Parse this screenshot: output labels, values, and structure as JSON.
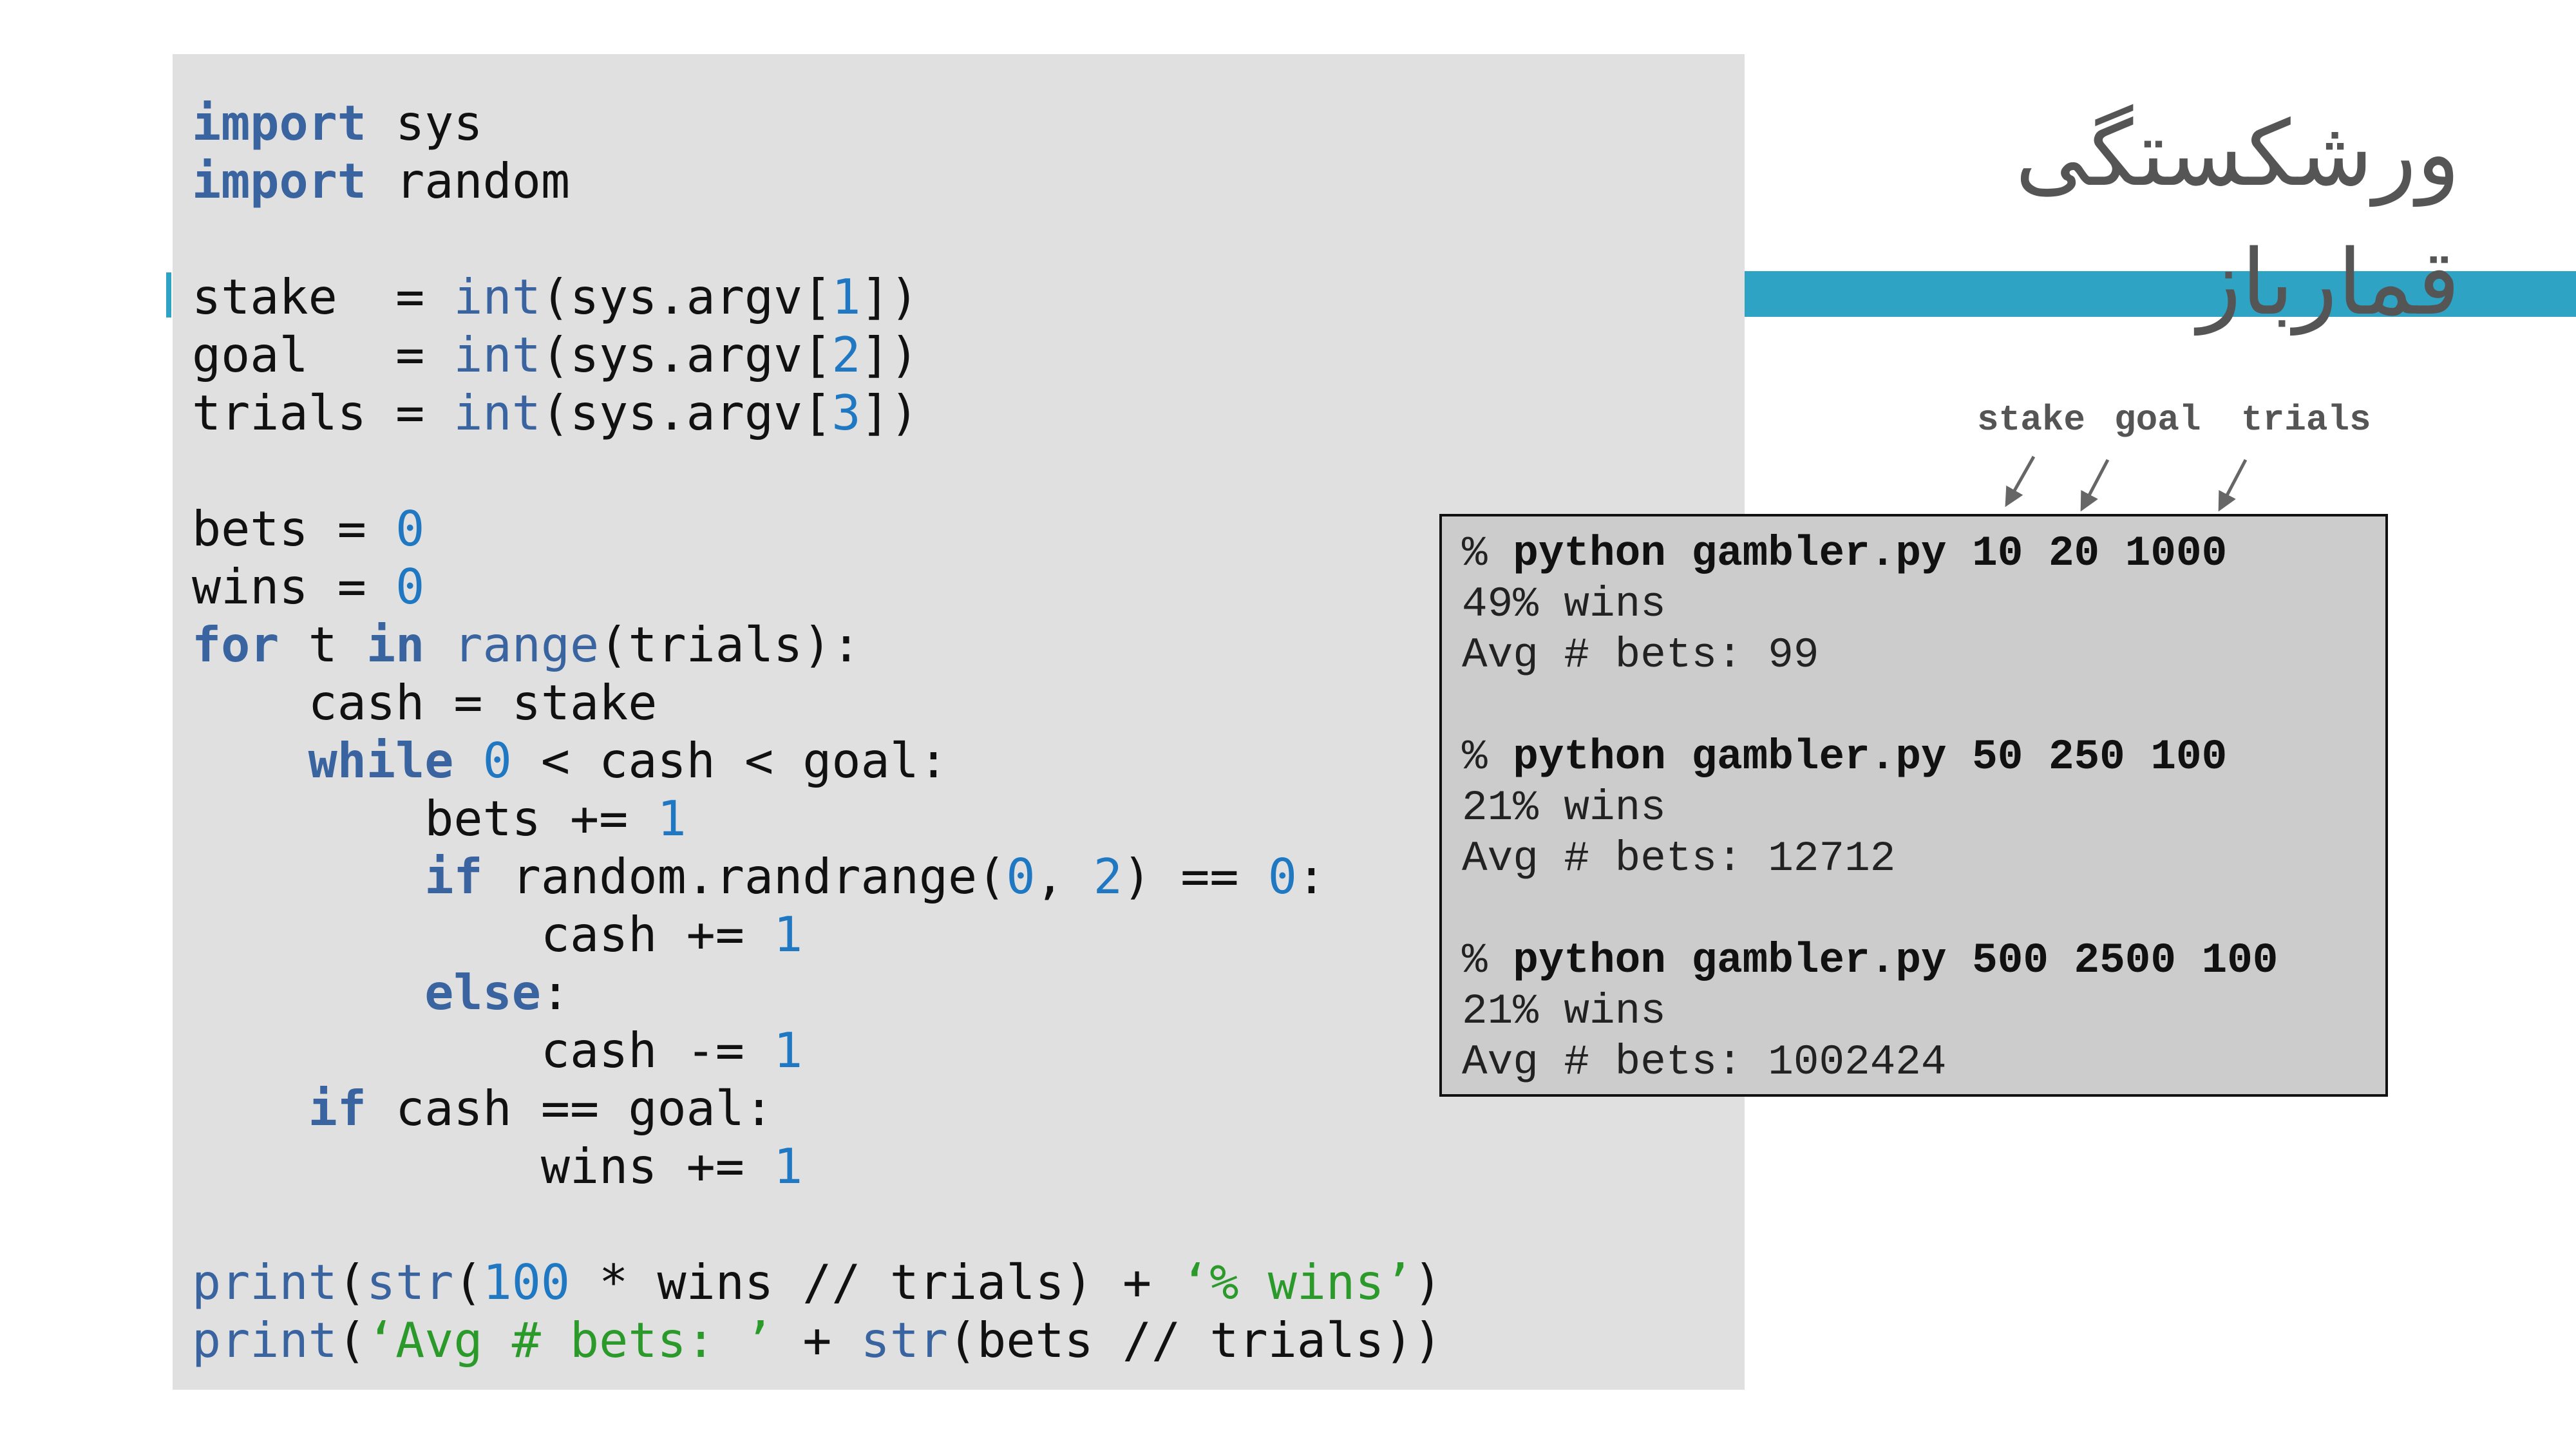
{
  "slide_title": "ورشکستگی قمارباز",
  "colors": {
    "accent": "#2fa3c3",
    "keyword": "#3a64a0",
    "number": "#1f78c1",
    "string": "#2b9a2b",
    "panel": "#e0e0e0",
    "terminal": "#cccccc"
  },
  "code_lines": [
    [
      [
        "import",
        "kw"
      ],
      [
        " sys",
        ""
      ]
    ],
    [
      [
        "import",
        "kw"
      ],
      [
        " random",
        ""
      ]
    ],
    [],
    [
      [
        "stake  = ",
        ""
      ],
      [
        "int",
        "fn"
      ],
      [
        "(sys.argv[",
        ""
      ],
      [
        "1",
        "num"
      ],
      [
        "])",
        ""
      ]
    ],
    [
      [
        "goal   = ",
        ""
      ],
      [
        "int",
        "fn"
      ],
      [
        "(sys.argv[",
        ""
      ],
      [
        "2",
        "num"
      ],
      [
        "])",
        ""
      ]
    ],
    [
      [
        "trials = ",
        ""
      ],
      [
        "int",
        "fn"
      ],
      [
        "(sys.argv[",
        ""
      ],
      [
        "3",
        "num"
      ],
      [
        "])",
        ""
      ]
    ],
    [],
    [
      [
        "bets = ",
        ""
      ],
      [
        "0",
        "num"
      ]
    ],
    [
      [
        "wins = ",
        ""
      ],
      [
        "0",
        "num"
      ]
    ],
    [
      [
        "for",
        "kw"
      ],
      [
        " t ",
        ""
      ],
      [
        "in",
        "kw"
      ],
      [
        " ",
        ""
      ],
      [
        "range",
        "fn"
      ],
      [
        "(trials):",
        ""
      ]
    ],
    [
      [
        "    cash = stake",
        ""
      ]
    ],
    [
      [
        "    ",
        ""
      ],
      [
        "while",
        "kw"
      ],
      [
        " ",
        ""
      ],
      [
        "0",
        "num"
      ],
      [
        " < cash < goal:",
        ""
      ]
    ],
    [
      [
        "        bets += ",
        ""
      ],
      [
        "1",
        "num"
      ]
    ],
    [
      [
        "        ",
        ""
      ],
      [
        "if",
        "kw"
      ],
      [
        " random.randrange(",
        ""
      ],
      [
        "0",
        "num"
      ],
      [
        ", ",
        ""
      ],
      [
        "2",
        "num"
      ],
      [
        ") == ",
        ""
      ],
      [
        "0",
        "num"
      ],
      [
        ":",
        ""
      ]
    ],
    [
      [
        "            cash += ",
        ""
      ],
      [
        "1",
        "num"
      ]
    ],
    [
      [
        "        ",
        ""
      ],
      [
        "else",
        "kw"
      ],
      [
        ":",
        ""
      ]
    ],
    [
      [
        "            cash -= ",
        ""
      ],
      [
        "1",
        "num"
      ]
    ],
    [
      [
        "    ",
        ""
      ],
      [
        "if",
        "kw"
      ],
      [
        " cash == goal:",
        ""
      ]
    ],
    [
      [
        "            wins += ",
        ""
      ],
      [
        "1",
        "num"
      ]
    ],
    [],
    [
      [
        "print",
        "fn"
      ],
      [
        "(",
        ""
      ],
      [
        "str",
        "fn"
      ],
      [
        "(",
        ""
      ],
      [
        "100",
        "num"
      ],
      [
        " * wins // trials) + ",
        ""
      ],
      [
        "‘% wins’",
        "str"
      ],
      [
        ")",
        ""
      ]
    ],
    [
      [
        "print",
        "fn"
      ],
      [
        "(",
        ""
      ],
      [
        "‘Avg # bets: ’",
        "str"
      ],
      [
        " + ",
        ""
      ],
      [
        "str",
        "fn"
      ],
      [
        "(bets // trials))",
        ""
      ]
    ]
  ],
  "arg_labels": {
    "stake": "stake",
    "goal": "goal",
    "trials": "trials"
  },
  "terminal": {
    "runs": [
      {
        "prompt": "%",
        "command": "python gambler.py 10 20 1000",
        "wins": "49% wins",
        "avg": "Avg # bets: 99"
      },
      {
        "prompt": "%",
        "command": "python gambler.py 50 250 100",
        "wins": "21% wins",
        "avg": "Avg # bets: 12712"
      },
      {
        "prompt": "%",
        "command": "python gambler.py 500 2500 100",
        "wins": "21% wins",
        "avg": "Avg # bets: 1002424"
      }
    ]
  }
}
